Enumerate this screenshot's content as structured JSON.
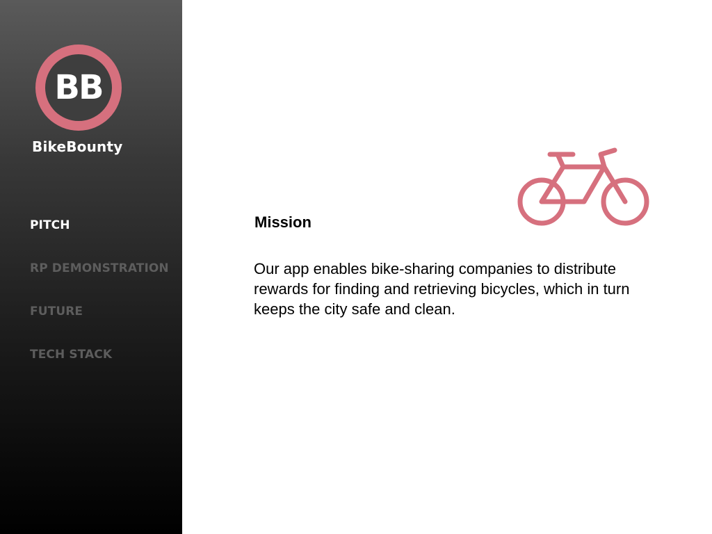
{
  "brand": {
    "logo_initials": "BB",
    "logo_name": "BikeBounty",
    "accent_color": "#d6707e"
  },
  "sidebar": {
    "items": [
      {
        "label": "PITCH",
        "active": true
      },
      {
        "label": "RP DEMONSTRATION",
        "active": false
      },
      {
        "label": "FUTURE",
        "active": false
      },
      {
        "label": "TECH STACK",
        "active": false
      }
    ]
  },
  "main": {
    "icon": "bicycle-icon",
    "heading": "Mission",
    "body": "Our app enables bike-sharing companies to distribute rewards for finding and retrieving bicycles, which in turn keeps the city safe and clean."
  }
}
